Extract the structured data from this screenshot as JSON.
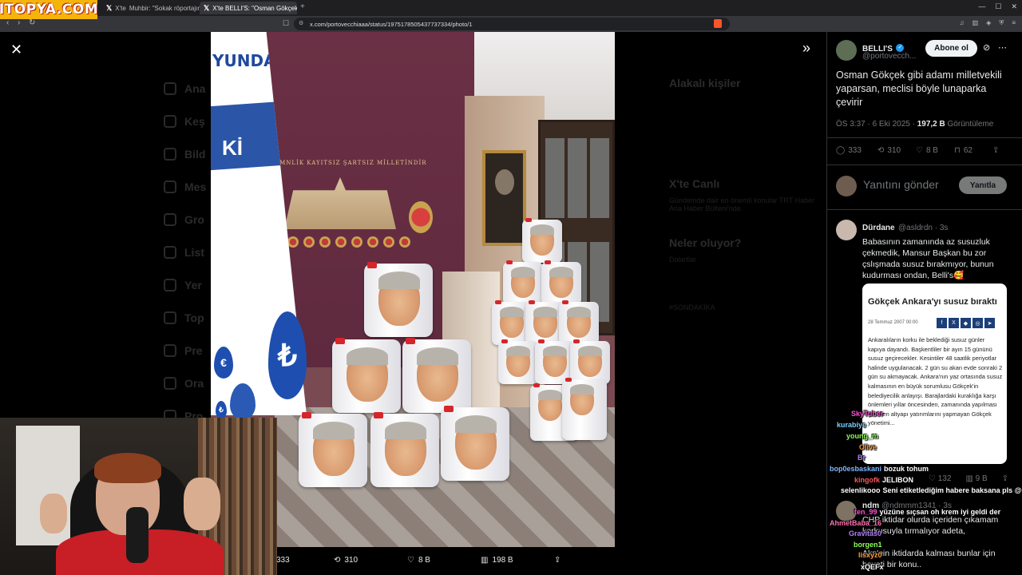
{
  "browser": {
    "logo": "ITOPYA.COM",
    "tabs": [
      {
        "label": "X'te",
        "extra": "Muhbir: \"Sokak röportajında"
      },
      {
        "label": "X'te BELLI'S: \"Osman Gökçek gibi"
      }
    ],
    "url": "x.com/portovecchiaaa/status/1975178505437737334/photo/1"
  },
  "background": {
    "nav": [
      "Ana",
      "Keş",
      "Bild",
      "Mes",
      "Gro",
      "List",
      "Yer",
      "Top",
      "Pre",
      "Ora",
      "Pro"
    ],
    "right": {
      "h1": "Alakalı kişiler",
      "h2": "X'te Canlı",
      "live": "Gündemde dair en önemli konular TRT Haber Ana Haber Bülteni'nde.",
      "h3": "Neler oluyor?",
      "t1": "Dolartlar",
      "t2": "#SONDAKİKA"
    }
  },
  "photo": {
    "banner_text": "YUNDA",
    "banner_ki": "Kİ",
    "plaque": "EMNLİK KAYITSIZ ŞARTSIZ MİLLETİNDİR",
    "footer": {
      "replies": "333",
      "reposts": "310",
      "likes": "8 B",
      "views": "198 B"
    }
  },
  "tweet": {
    "author_name": "BELLI'S",
    "author_handle": "@portovecch...",
    "subscribe_label": "Abone ol",
    "text": "Osman Gökçek gibi adamı milletvekili yaparsan, meclisi böyle lunaparka çevirir",
    "time": "ÖS 3:37 · 6 Eki 2025 · ",
    "views": "197,2 B",
    "views_label": " Görüntüleme",
    "replies": "333",
    "reposts": "310",
    "likes": "8 B",
    "bookmarks": "62"
  },
  "reply_box": {
    "placeholder": "Yanıtını gönder",
    "button": "Yanıtla"
  },
  "reply1": {
    "name": "Dürdane",
    "handle": "@asldrdn · 3s",
    "text": "Babasının zamanında az susuzluk çekmedik, Mansur Başkan bu zor çslışmada susuz bırakmıyor, bunun kudurması ondan, Belli's🥰",
    "card": {
      "title": "Gökçek Ankara'yı susuz bıraktı",
      "date": "28 Temmuz 2007 00:00",
      "body": "Ankaralıların korku ile beklediği susuz günler kapıya dayandı. Başkentliler bir ayın 15 gününü susuz geçirecekler. Kesintiler 48 saatlik periyotlar halinde uygulanacak. 2 gün su akan evde sonraki 2 gün su akmayacak. Ankara'nın yaz ortasında susuz kalmasının en büyük sorumlusu Gökçek'in belediyecilik anlayışı. Barajlardaki kuraklığa karşı önlemleri yıllar öncesinden, zamanında yapılması gereken altyapı yatırımlarını yapmayan Gökçek yönetimi..."
    },
    "likes": "132",
    "views": "9 B"
  },
  "reply2": {
    "name": "ndm",
    "handle": "@ndmmm1341 · 3s",
    "text": "CHP iktidar olurda içeriden çıkamam korkusuyla tırmalıyor adeta,\n\nAkp'nin iktidarda kalması bunlar için hayati bir konu.."
  },
  "chat": [
    {
      "user": "SkyTuber",
      "color": "#ff4fd8",
      "msg": ""
    },
    {
      "user": "kurabiye",
      "color": "#7ad0ff",
      "msg": ""
    },
    {
      "user": "young_m",
      "color": "#8cff5a",
      "msg": ""
    },
    {
      "user": "Olive",
      "color": "#ff9a3c",
      "msg": ""
    },
    {
      "user": "Br",
      "color": "#b57bff",
      "msg": ""
    },
    {
      "user": "bop0esbaskani",
      "color": "#7fb6ff",
      "msg": "bozuk tohum"
    },
    {
      "user": "kingofk",
      "color": "#ff5555",
      "msg": "JELIBON"
    },
    {
      "user": "selenlikooo",
      "color": "#ffffff",
      "msg": "Seni etiketlediğim habere baksana pls @PurpleBixi"
    },
    {
      "user": "ten_99",
      "color": "#ff4fd8",
      "msg": "yüzüne sıçsan oh krem iyi geldi der"
    },
    {
      "user": "AhmetBaba_16",
      "color": "#ff6fb0",
      "msg": ""
    },
    {
      "user": "Gravitas0",
      "color": "#b57bff",
      "msg": ""
    },
    {
      "user": "borgen1",
      "color": "#8cff5a",
      "msg": ""
    },
    {
      "user": "lisxyz0",
      "color": "#ff9a3c",
      "msg": ""
    },
    {
      "user": "xQEFx",
      "color": "#ffffff",
      "msg": ""
    }
  ],
  "colors": {
    "accent": "#1d9bf0",
    "bg": "#000000",
    "muted": "#71767b"
  }
}
